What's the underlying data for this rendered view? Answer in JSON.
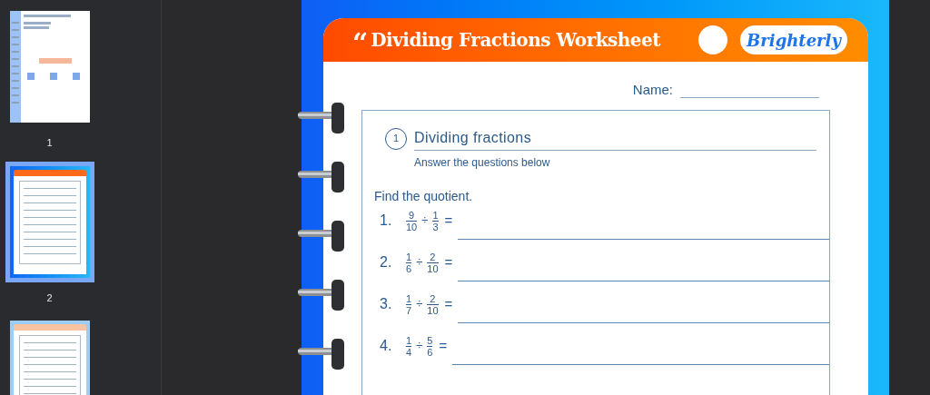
{
  "thumbnails": [
    {
      "page": "1",
      "selected": false,
      "kind": "promo"
    },
    {
      "page": "2",
      "selected": true,
      "kind": "worksheet"
    },
    {
      "kind": "worksheet_faded",
      "selected": false
    }
  ],
  "worksheet": {
    "quote_mark": "“",
    "title": "Dividing Fractions Worksheet",
    "logo": "Brighterly",
    "name_label": "Name:",
    "section": {
      "number": "1",
      "title": "Dividing fractions",
      "subtitle": "Answer the questions below"
    },
    "instruction": "Find the quotient.",
    "questions": [
      {
        "number": "1.",
        "a": {
          "num": "9",
          "den": "10"
        },
        "op": "÷",
        "b": {
          "num": "1",
          "den": "3"
        },
        "eq": "="
      },
      {
        "number": "2.",
        "a": {
          "num": "1",
          "den": "6"
        },
        "op": "÷",
        "b": {
          "num": "2",
          "den": "10"
        },
        "eq": "="
      },
      {
        "number": "3.",
        "a": {
          "num": "1",
          "den": "7"
        },
        "op": "÷",
        "b": {
          "num": "2",
          "den": "10"
        },
        "eq": "="
      },
      {
        "number": "4.",
        "a": {
          "num": "1",
          "den": "4"
        },
        "op": "÷",
        "b": {
          "num": "5",
          "den": "6"
        },
        "eq": "="
      }
    ]
  }
}
